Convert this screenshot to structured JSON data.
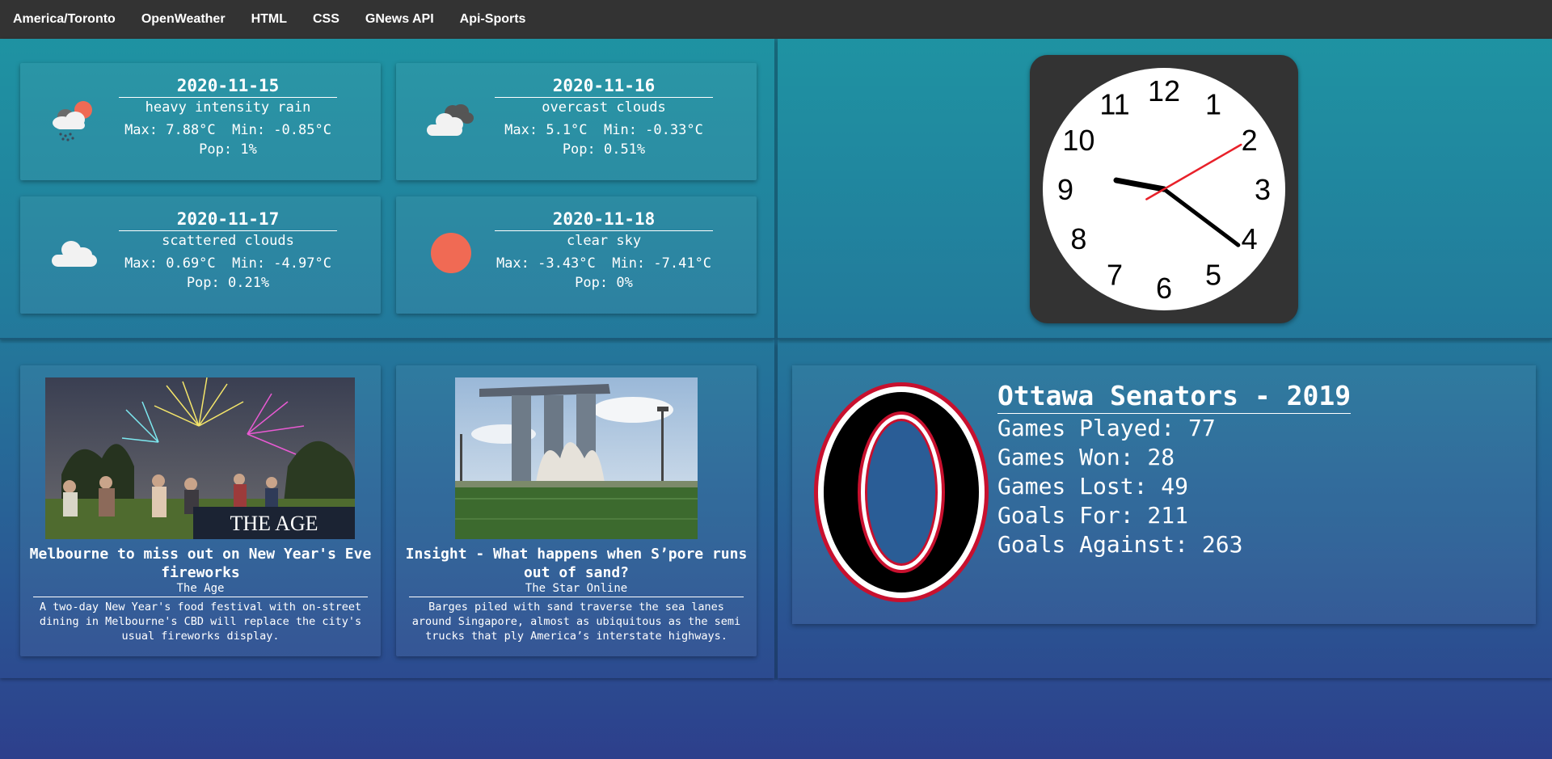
{
  "nav": {
    "items": [
      "America/Toronto",
      "OpenWeather",
      "HTML",
      "CSS",
      "GNews API",
      "Api-Sports"
    ]
  },
  "weather": [
    {
      "date": "2020-11-15",
      "desc": "heavy intensity rain",
      "maxmin": "Max: 7.88°C  Min: -0.85°C",
      "pop": "Pop: 1%",
      "icon": "rain-sun-icon"
    },
    {
      "date": "2020-11-16",
      "desc": "overcast clouds",
      "maxmin": "Max: 5.1°C  Min: -0.33°C",
      "pop": "Pop: 0.51%",
      "icon": "overcast-clouds-icon"
    },
    {
      "date": "2020-11-17",
      "desc": "scattered clouds",
      "maxmin": "Max: 0.69°C  Min: -4.97°C",
      "pop": "Pop: 0.21%",
      "icon": "cloud-icon"
    },
    {
      "date": "2020-11-18",
      "desc": "clear sky",
      "maxmin": "Max: -3.43°C  Min: -7.41°C",
      "pop": "Pop: 0%",
      "icon": "sun-icon"
    }
  ],
  "clock": {
    "numerals": [
      "12",
      "1",
      "2",
      "3",
      "4",
      "5",
      "6",
      "7",
      "8",
      "9",
      "10",
      "11"
    ],
    "hour": 9,
    "minute": 21,
    "second": 10,
    "accent": "#e8212a"
  },
  "news": [
    {
      "title": "Melbourne to miss out on New Year's Eve fireworks",
      "source": "The Age",
      "desc": "A two-day New Year's food festival with on-street dining in Melbourne's CBD will replace the city's usual fireworks display.",
      "image_caption": "THE AGE"
    },
    {
      "title": "Insight - What happens when S’pore runs out of sand?",
      "source": "The Star Online",
      "desc": "Barges piled with sand traverse the sea lanes around Singapore, almost as ubiquitous as the semi trucks that ply America’s interstate highways."
    }
  ],
  "sports": {
    "title": "Ottawa Senators - 2019",
    "lines": [
      "Games Played: 77",
      "Games Won: 28",
      "Games Lost: 49",
      "Goals For: 211",
      "Goals Against: 263"
    ],
    "logo_colors": {
      "red": "#c8102e",
      "black": "#000000",
      "white": "#ffffff"
    }
  },
  "colors": {
    "nav_bg": "#333333",
    "sun": "#f06a54",
    "cloud": "#f2f2f2"
  }
}
